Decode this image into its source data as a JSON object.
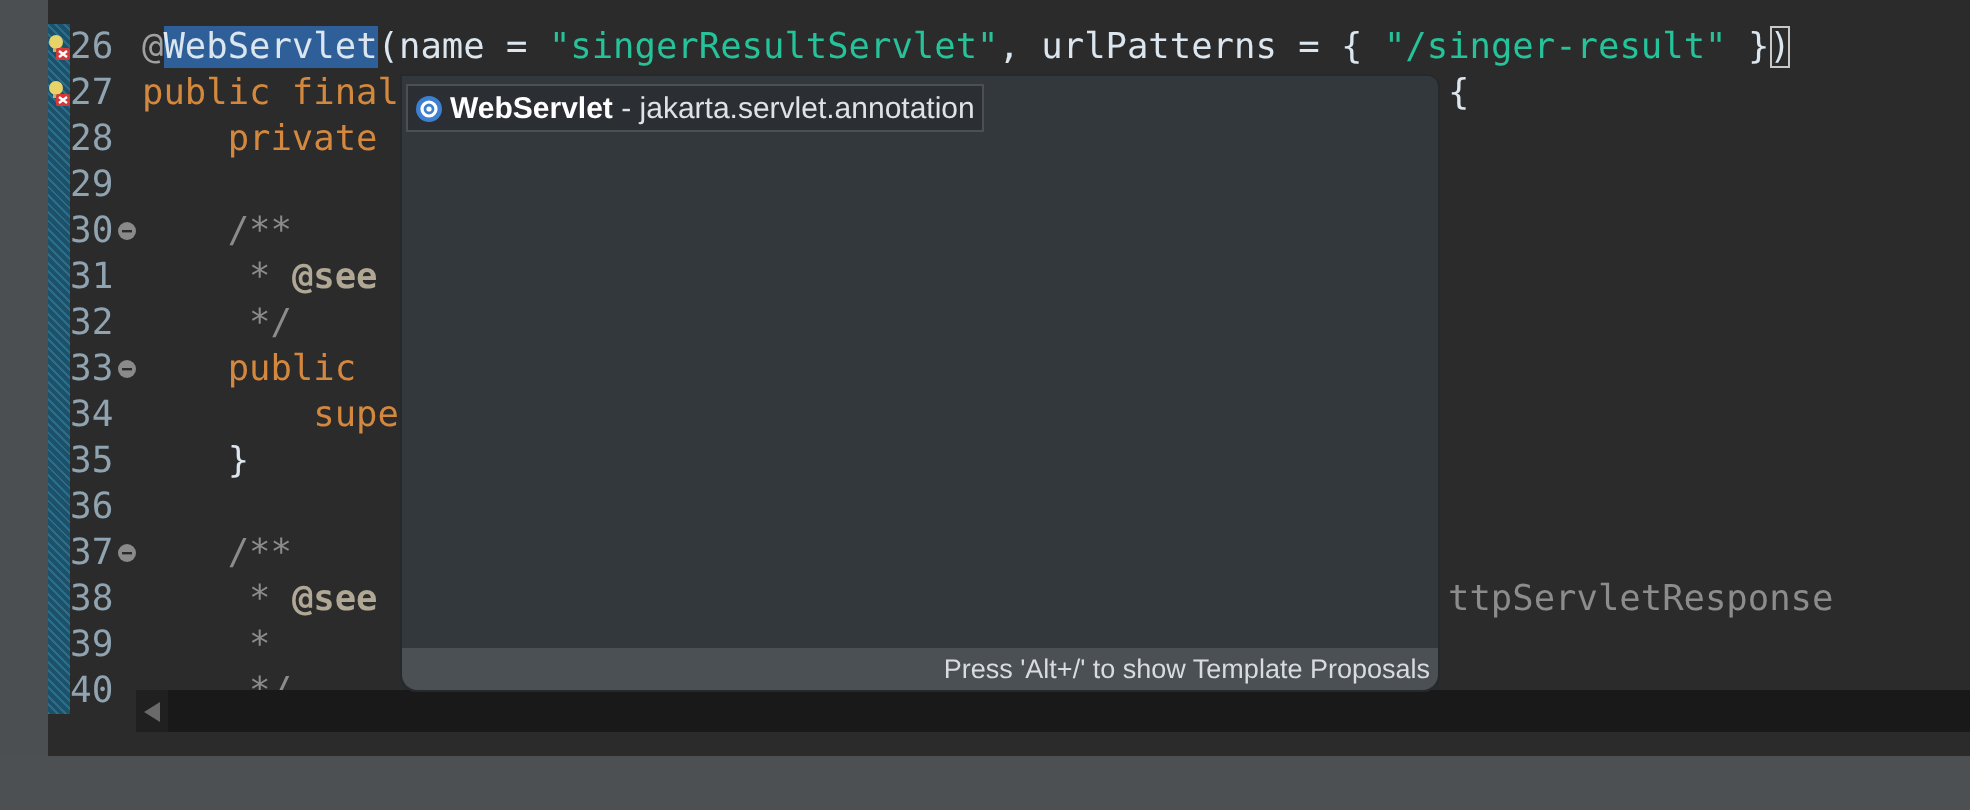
{
  "editor": {
    "lines": [
      {
        "number": "26",
        "has_error": true,
        "foldable": false,
        "tokens": [
          {
            "text": "@",
            "kind": "annotation"
          },
          {
            "text": "WebServlet",
            "kind": "plain",
            "selected": true
          },
          {
            "text": "(name = ",
            "kind": "plain"
          },
          {
            "text": "\"singerResultServlet\"",
            "kind": "string"
          },
          {
            "text": ", urlPatterns = { ",
            "kind": "plain"
          },
          {
            "text": "\"/singer-result\"",
            "kind": "string"
          },
          {
            "text": " }",
            "kind": "plain"
          },
          {
            "text": ")",
            "kind": "plain",
            "matched": true
          }
        ]
      },
      {
        "number": "27",
        "has_error": true,
        "foldable": false,
        "tokens": [
          {
            "text": "public final",
            "kind": "keyword"
          }
        ],
        "tail": [
          {
            "text": "{",
            "kind": "plain"
          }
        ]
      },
      {
        "number": "28",
        "foldable": false,
        "tokens": [
          {
            "text": "    private",
            "kind": "keyword"
          }
        ]
      },
      {
        "number": "29",
        "foldable": false
      },
      {
        "number": "30",
        "foldable": true,
        "tokens": [
          {
            "text": "    /**",
            "kind": "comment"
          }
        ]
      },
      {
        "number": "31",
        "foldable": false,
        "tokens": [
          {
            "text": "     * ",
            "kind": "comment"
          },
          {
            "text": "@see",
            "kind": "doctag"
          }
        ]
      },
      {
        "number": "32",
        "foldable": false,
        "tokens": [
          {
            "text": "     */",
            "kind": "comment"
          }
        ]
      },
      {
        "number": "33",
        "foldable": true,
        "tokens": [
          {
            "text": "    public",
            "kind": "keyword"
          }
        ]
      },
      {
        "number": "34",
        "foldable": false,
        "tokens": [
          {
            "text": "        supe",
            "kind": "keyword"
          }
        ]
      },
      {
        "number": "35",
        "foldable": false,
        "tokens": [
          {
            "text": "    }",
            "kind": "plain"
          }
        ]
      },
      {
        "number": "36",
        "foldable": false
      },
      {
        "number": "37",
        "foldable": true,
        "tokens": [
          {
            "text": "    /**",
            "kind": "comment"
          }
        ]
      },
      {
        "number": "38",
        "foldable": false,
        "tokens": [
          {
            "text": "     * ",
            "kind": "comment"
          },
          {
            "text": "@see",
            "kind": "doctag"
          }
        ],
        "tail": [
          {
            "text": "ttpServletResponse",
            "kind": "comment"
          }
        ]
      },
      {
        "number": "39",
        "foldable": false,
        "tokens": [
          {
            "text": "     *",
            "kind": "comment"
          }
        ]
      },
      {
        "number": "40",
        "foldable": false,
        "tokens": [
          {
            "text": "     */",
            "kind": "comment"
          }
        ]
      }
    ]
  },
  "completion_popup": {
    "proposals": [
      {
        "name": "WebServlet",
        "detail": " - jakarta.servlet.annotation",
        "kind": "annotation",
        "selected": true
      }
    ],
    "status": "Press 'Alt+/' to show Template Proposals"
  }
}
